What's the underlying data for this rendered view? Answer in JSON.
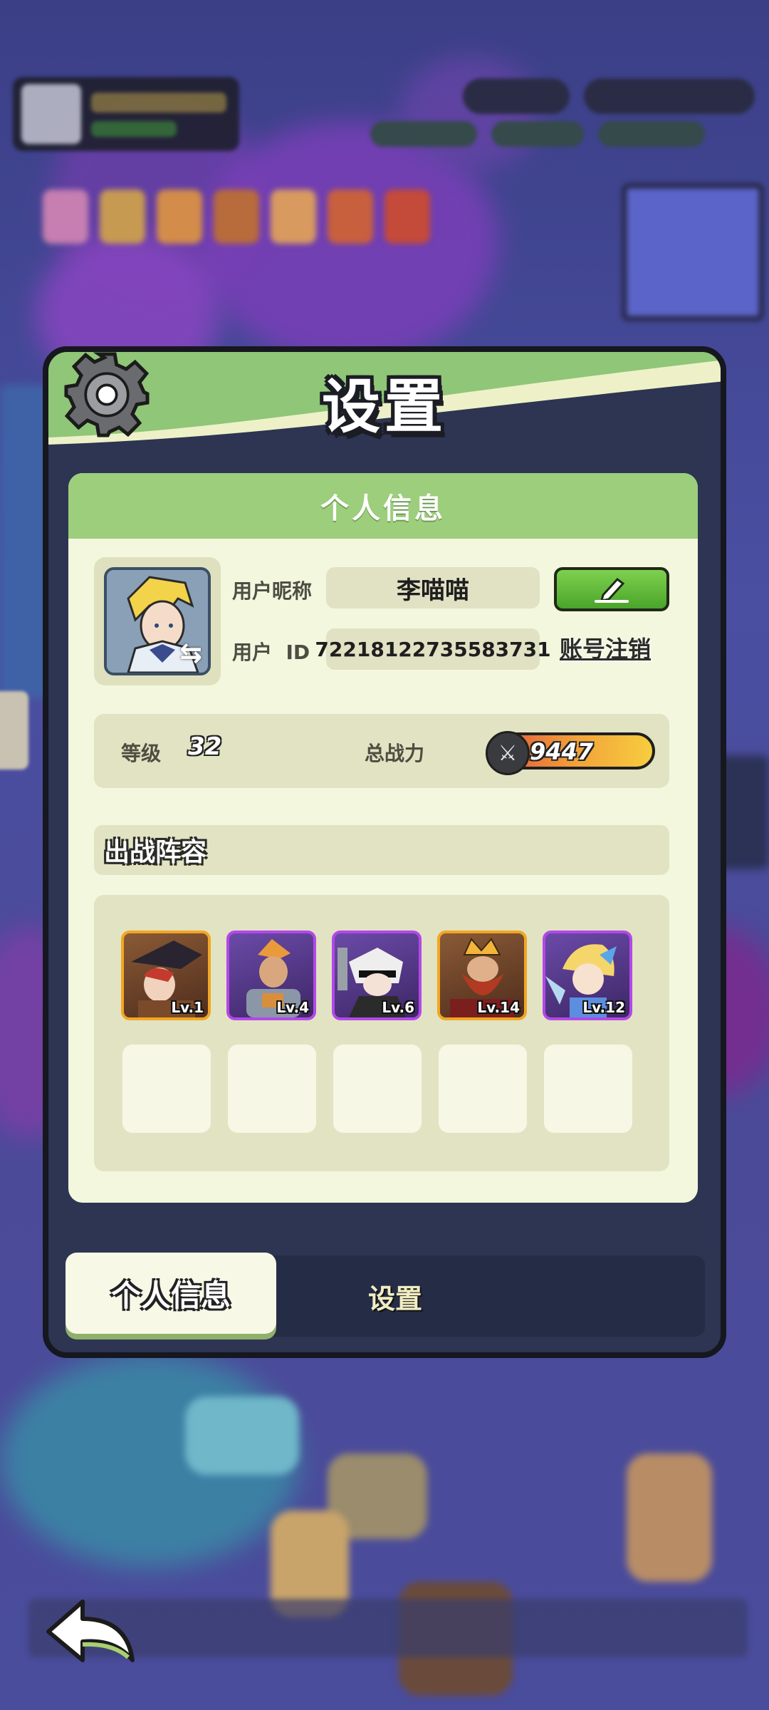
{
  "panel": {
    "title": "设置",
    "section_header": "个人信息"
  },
  "profile": {
    "nickname_label": "用户昵称",
    "nickname_value": "李喵喵",
    "id_label": "用户  ID",
    "id_value": "72218122735583731",
    "logout_label": "账号注销"
  },
  "stats": {
    "level_label": "等级",
    "level_value": "32",
    "power_label": "总战力",
    "power_value": "9447"
  },
  "team": {
    "title": "出战阵容",
    "heroes": [
      {
        "level": "Lv.1",
        "rarity": "gold"
      },
      {
        "level": "Lv.4",
        "rarity": "purple"
      },
      {
        "level": "Lv.6",
        "rarity": "purple"
      },
      {
        "level": "Lv.14",
        "rarity": "gold"
      },
      {
        "level": "Lv.12",
        "rarity": "purple"
      }
    ],
    "empty_slots": 5
  },
  "tabs": {
    "profile_tab": "个人信息",
    "settings_tab": "设置"
  },
  "icons": {
    "gear": "gear-icon",
    "edit": "pencil-icon",
    "swap": "swap-arrows-icon",
    "power": "crossed-swords-icon",
    "back": "back-arrow-icon"
  },
  "colors": {
    "header_green": "#8fc677",
    "card_bg": "#f3f7de",
    "panel_dark": "#2d3552",
    "edit_button": "#5bb835",
    "gold_frame": "#f2a623",
    "purple_frame": "#b348e8"
  }
}
